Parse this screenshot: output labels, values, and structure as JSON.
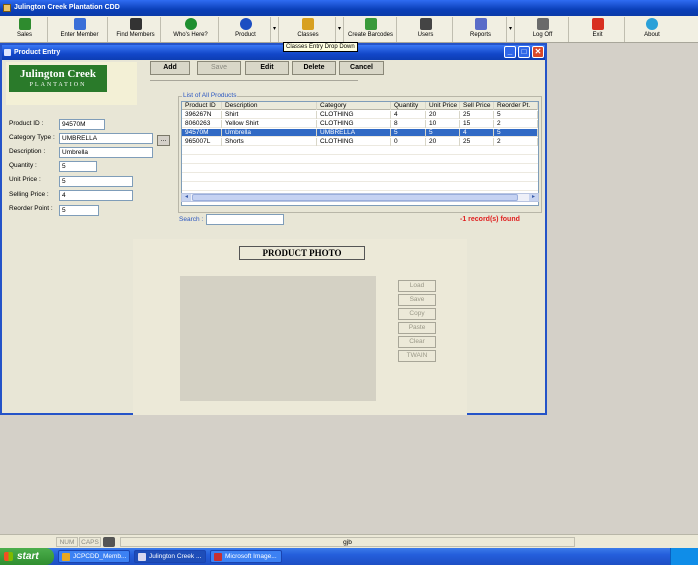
{
  "app": {
    "title": "Julington Creek Plantation CDD"
  },
  "toolbar": {
    "buttons": [
      {
        "label": "Sales",
        "icon": "sales-icon",
        "color": "#2e8b2e"
      },
      {
        "label": "Enter Member",
        "icon": "enter-member-icon",
        "color": "#3a6fd8"
      },
      {
        "label": "Find Members",
        "icon": "binoculars-icon",
        "color": "#333333"
      },
      {
        "label": "Who's Here?",
        "icon": "question-icon",
        "color": "#1f8f2f"
      },
      {
        "label": "Product",
        "icon": "product-icon",
        "color": "#1c4ec2"
      },
      {
        "label": "Classes",
        "icon": "classes-icon",
        "color": "#d8a020"
      },
      {
        "label": "Create Barcodes",
        "icon": "barcode-icon",
        "color": "#3a9a3a"
      },
      {
        "label": "Users",
        "icon": "users-icon",
        "color": "#444444"
      },
      {
        "label": "Reports",
        "icon": "reports-icon",
        "color": "#5a6cc8"
      },
      {
        "label": "Log Off",
        "icon": "log-off-icon",
        "color": "#6a6a6a"
      },
      {
        "label": "Exit",
        "icon": "exit-icon",
        "color": "#d83020"
      },
      {
        "label": "About",
        "icon": "about-icon",
        "color": "#2aa0d8"
      }
    ],
    "dropdown_arrow": "▾",
    "tooltip": "Classes Entry Drop Down"
  },
  "window": {
    "title": "Product Entry",
    "controls": {
      "minimize": "_",
      "maximize": "□",
      "close": "✕"
    },
    "logo": {
      "line1": "Julington Creek",
      "line2": "PLANTATION"
    },
    "actions": {
      "add": "Add",
      "save": "Save",
      "edit": "Edit",
      "delete": "Delete",
      "cancel": "Cancel"
    },
    "form": {
      "product_id_label": "Product ID :",
      "product_id": "94570M",
      "category_type_label": "Category Type :",
      "category_type": "UMBRELLA",
      "browse": "...",
      "description_label": "Description :",
      "description": "Umbrella",
      "quantity_label": "Quantity :",
      "quantity": "5",
      "unit_price_label": "Unit Price :",
      "unit_price": "5",
      "selling_price_label": "Selling Price :",
      "selling_price": "4",
      "reorder_point_label": "Reorder Point :",
      "reorder_point": "5"
    },
    "grid": {
      "group_label": "List of All Products",
      "columns": [
        "Product ID",
        "Description",
        "Category",
        "Quantity",
        "Unit Price",
        "Sell Price",
        "Reorder Pt."
      ],
      "rows": [
        [
          "396267N",
          "Shirt",
          "CLOTHING",
          "4",
          "20",
          "25",
          "5"
        ],
        [
          "8060263",
          "Yellow Shirt",
          "CLOTHING",
          "8",
          "10",
          "15",
          "2"
        ],
        [
          "94570M",
          "Umbrella",
          "UMBRELLA",
          "5",
          "5",
          "4",
          "5"
        ],
        [
          "965007L",
          "Shorts",
          "CLOTHING",
          "0",
          "20",
          "25",
          "2"
        ]
      ],
      "selected_row": 2,
      "scroll_left": "◂",
      "scroll_right": "▸"
    },
    "search": {
      "label": "Search :",
      "value": ""
    },
    "records_found": "-1 record(s) found",
    "photo": {
      "title": "PRODUCT PHOTO",
      "buttons": [
        "Load",
        "Save",
        "Copy",
        "Paste",
        "Clear",
        "TWAIN"
      ]
    }
  },
  "statusbar": {
    "num": "NUM",
    "caps": "CAPS",
    "user": "gjb"
  },
  "taskbar": {
    "start": "start",
    "tasks": [
      {
        "label": "JCPCDD_Memb...",
        "color": "#e8a820",
        "active": false
      },
      {
        "label": "Julington Creek ...",
        "color": "#d8d8f0",
        "active": true
      },
      {
        "label": "Microsoft Image...",
        "color": "#c83030",
        "active": false
      }
    ]
  }
}
